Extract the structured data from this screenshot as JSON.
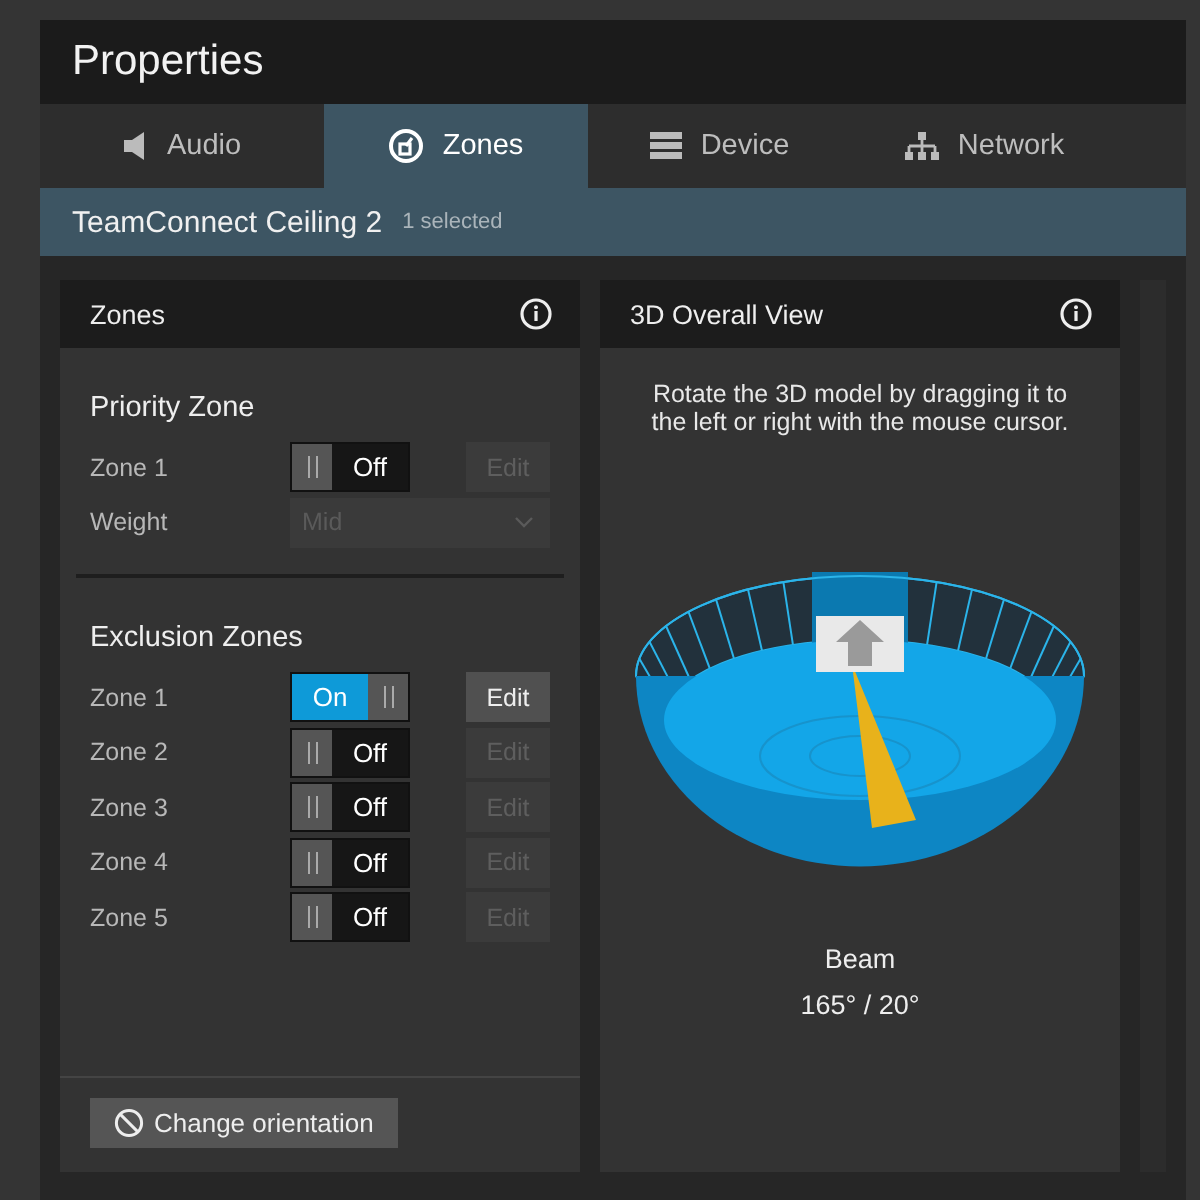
{
  "window": {
    "title": "Properties"
  },
  "tabs": [
    {
      "label": "Audio",
      "selected": false
    },
    {
      "label": "Zones",
      "selected": true
    },
    {
      "label": "Device",
      "selected": false
    },
    {
      "label": "Network",
      "selected": false
    }
  ],
  "device": {
    "name": "TeamConnect Ceiling 2",
    "selection": "1 selected"
  },
  "zones_panel": {
    "title": "Zones",
    "priority": {
      "heading": "Priority Zone",
      "zone": {
        "label": "Zone 1",
        "on": false,
        "toggle_text": "Off",
        "edit": "Edit",
        "edit_disabled": true
      },
      "weight": {
        "label": "Weight",
        "value": "Mid",
        "disabled": true
      }
    },
    "exclusion": {
      "heading": "Exclusion Zones",
      "zones": [
        {
          "label": "Zone 1",
          "on": true,
          "toggle_text": "On",
          "edit": "Edit",
          "edit_disabled": false
        },
        {
          "label": "Zone 2",
          "on": false,
          "toggle_text": "Off",
          "edit": "Edit",
          "edit_disabled": true
        },
        {
          "label": "Zone 3",
          "on": false,
          "toggle_text": "Off",
          "edit": "Edit",
          "edit_disabled": true
        },
        {
          "label": "Zone 4",
          "on": false,
          "toggle_text": "Off",
          "edit": "Edit",
          "edit_disabled": true
        },
        {
          "label": "Zone 5",
          "on": false,
          "toggle_text": "Off",
          "edit": "Edit",
          "edit_disabled": true
        }
      ]
    },
    "button": "Change orientation"
  },
  "view_panel": {
    "title": "3D Overall View",
    "hint": "Rotate the 3D model by dragging it to the left or right with the mouse cursor.",
    "beam_label": "Beam",
    "beam_value": "165° / 20°"
  }
}
